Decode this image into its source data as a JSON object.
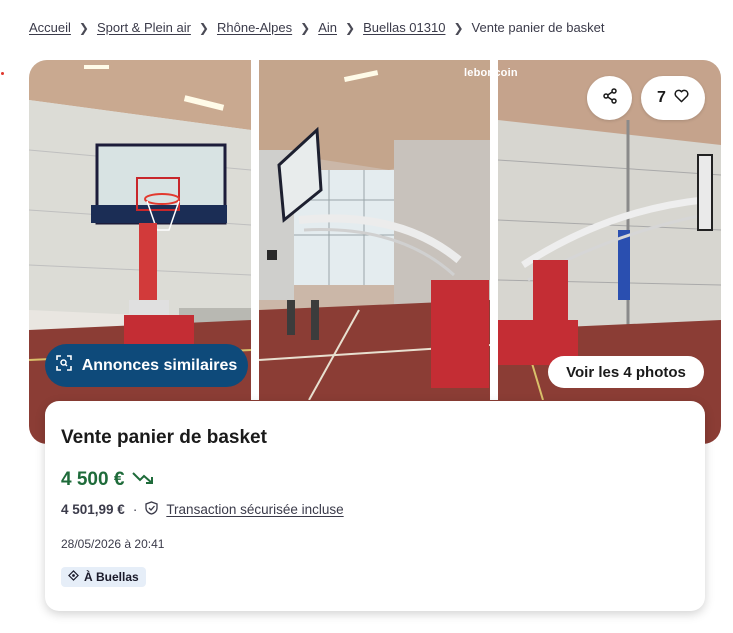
{
  "breadcrumb": {
    "items": [
      "Accueil",
      "Sport & Plein air",
      "Rhône-Alpes",
      "Ain",
      "Buellas 01310"
    ],
    "current": "Vente panier de basket"
  },
  "gallery": {
    "watermark": "leboncoin",
    "favorites_count": "7",
    "similar_label": "Annonces similaires",
    "photos_label": "Voir les 4 photos",
    "icons": [
      "share-icon",
      "heart-icon",
      "scan-icon"
    ]
  },
  "listing": {
    "title": "Vente panier de basket",
    "price": "4 500 €",
    "price_trend_icon": "trending-down-icon",
    "price_with_fees": "4 501,99 €",
    "separator": "·",
    "transaction_label": "Transaction sécurisée incluse",
    "date": "28/05/2026 à 20:41",
    "location": "À Buellas"
  },
  "colors": {
    "price_green": "#1e6b3a",
    "button_blue": "#0e4a7a",
    "badge_bg": "#e6eef8",
    "court_floor": "#8b3d35"
  }
}
